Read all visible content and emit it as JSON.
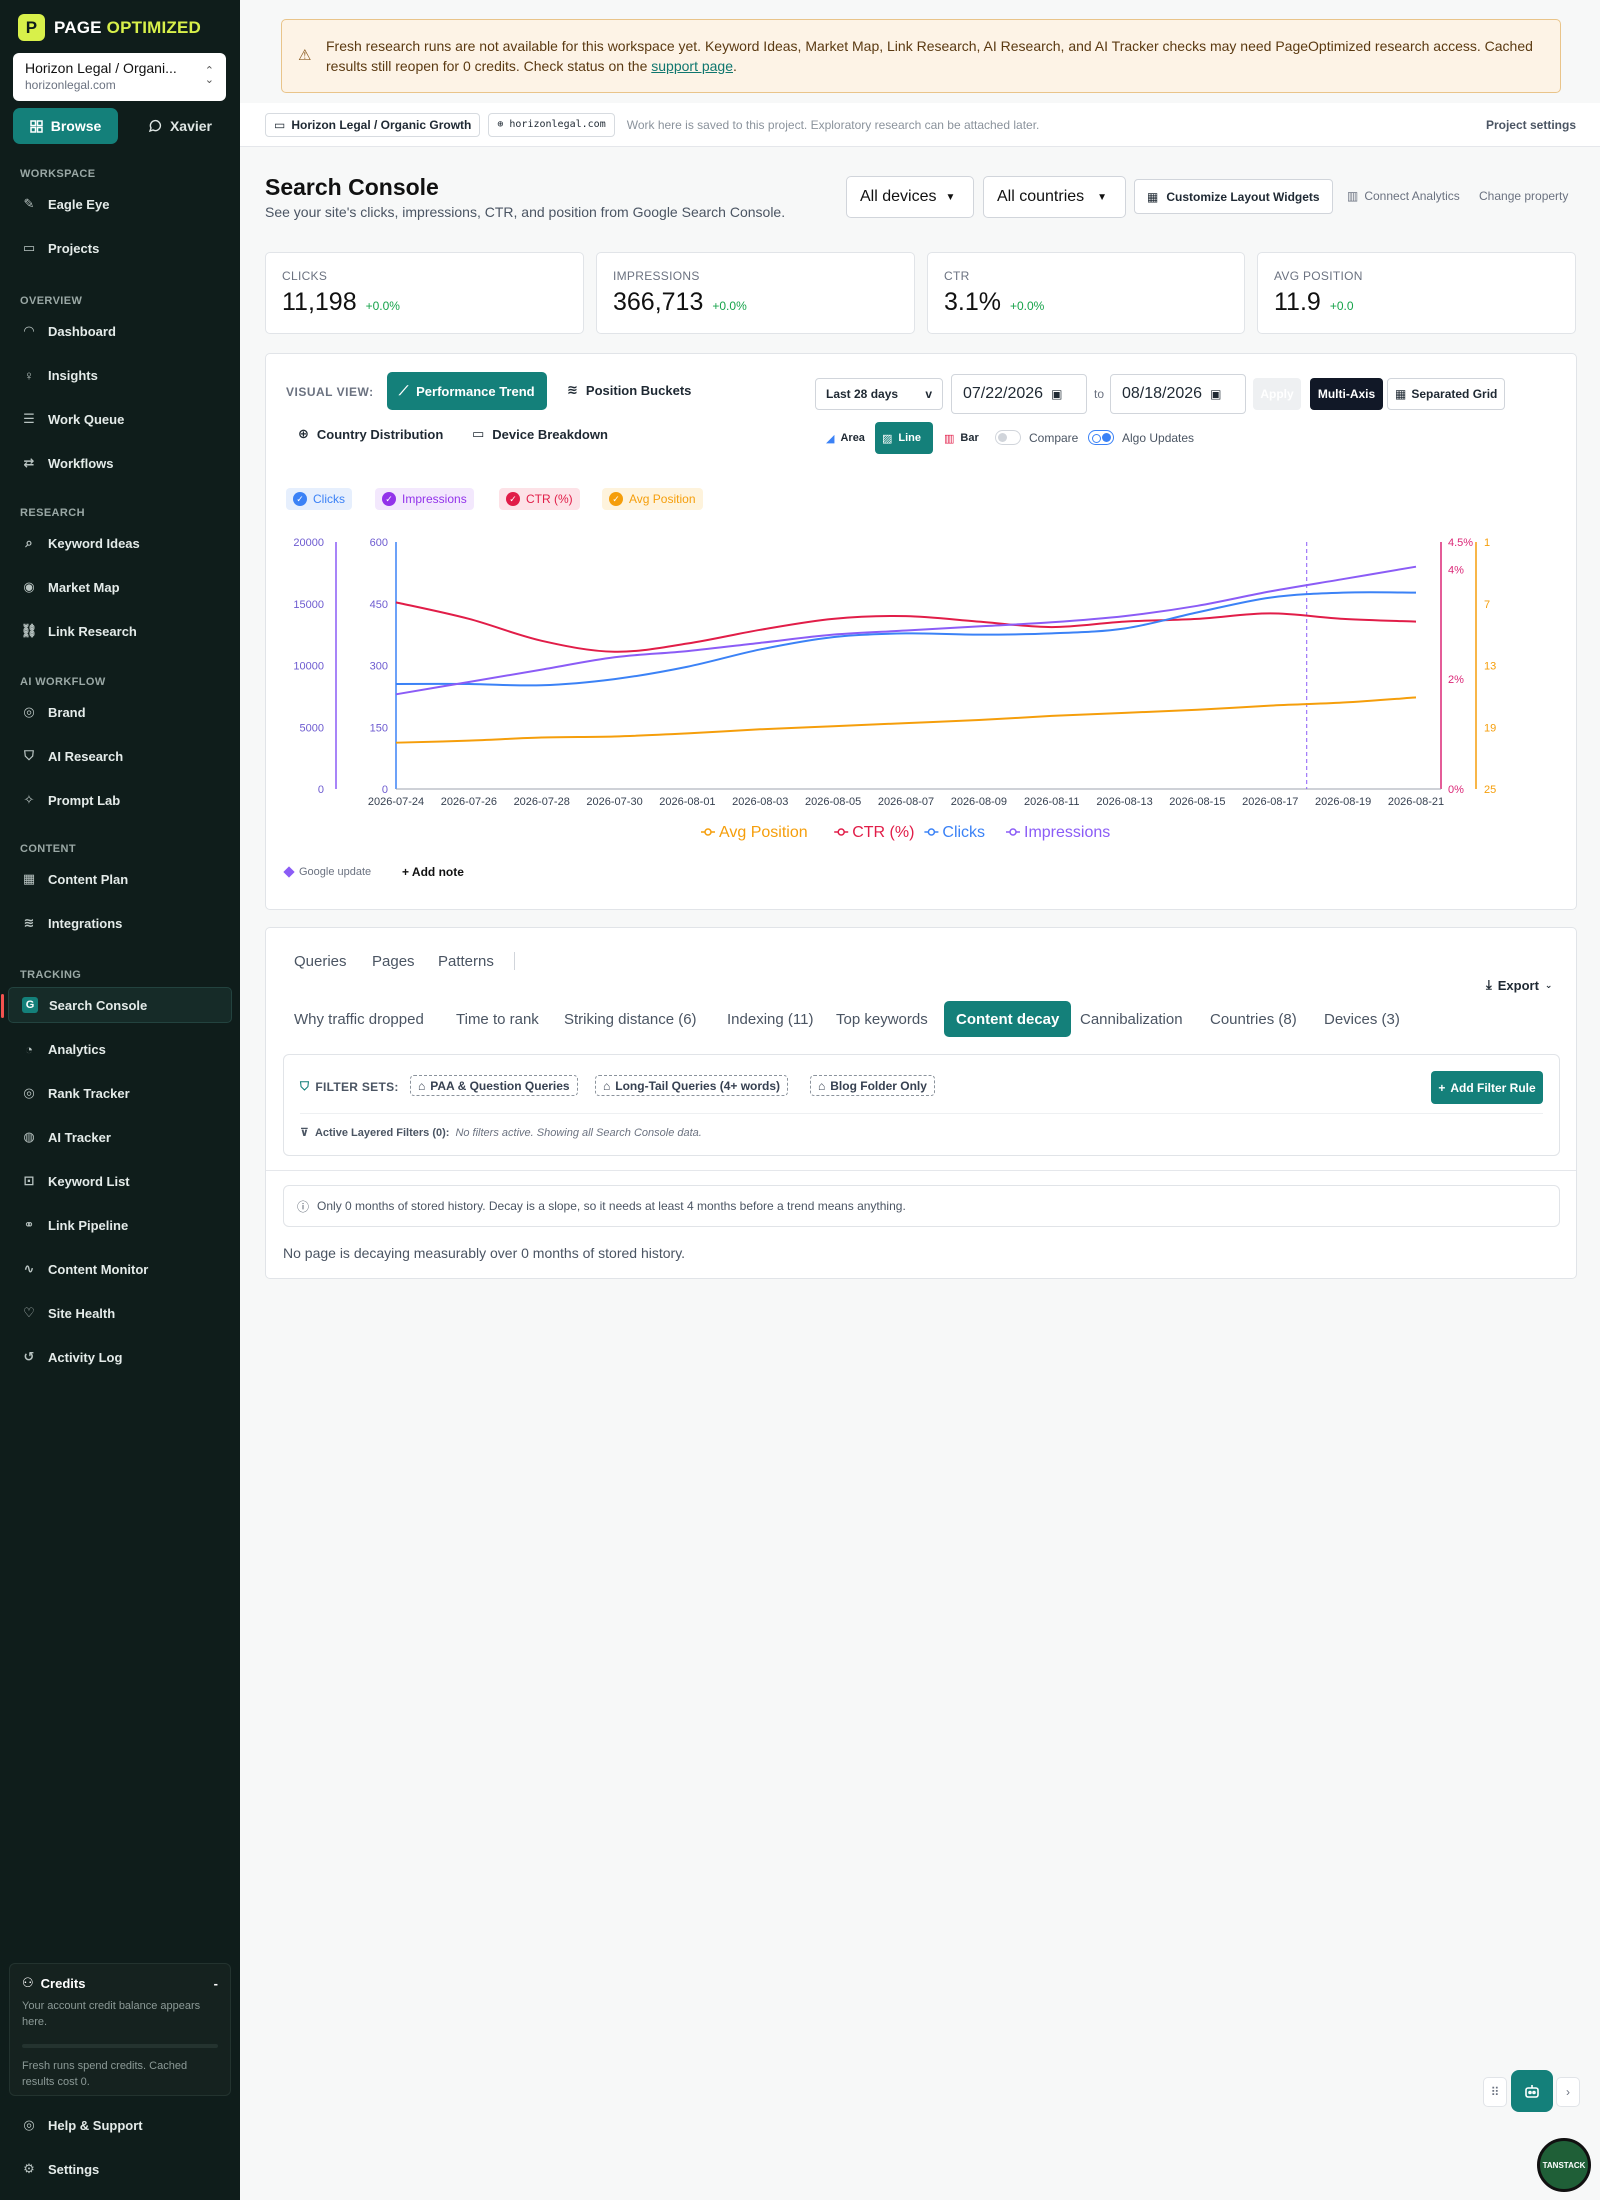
{
  "brand": {
    "name_a": "PAGE",
    "name_b": "OPTIMIZED",
    "mark": "P"
  },
  "project_switcher": {
    "name": "Horizon Legal / Organi...",
    "domain": "horizonlegal.com"
  },
  "mode_tabs": {
    "browse": "Browse",
    "xavier": "Xavier"
  },
  "sidebar": {
    "sections": [
      {
        "title": "WORKSPACE",
        "items": [
          {
            "label": "Eagle Eye",
            "icon": "eagle-icon"
          },
          {
            "label": "Projects",
            "icon": "projects-icon"
          }
        ]
      },
      {
        "title": "OVERVIEW",
        "items": [
          {
            "label": "Dashboard",
            "icon": "gauge-icon"
          },
          {
            "label": "Insights",
            "icon": "bulb-icon"
          },
          {
            "label": "Work Queue",
            "icon": "queue-icon"
          },
          {
            "label": "Workflows",
            "icon": "workflow-icon"
          }
        ]
      },
      {
        "title": "RESEARCH",
        "items": [
          {
            "label": "Keyword Ideas",
            "icon": "search-icon"
          },
          {
            "label": "Market Map",
            "icon": "map-icon"
          },
          {
            "label": "Link Research",
            "icon": "link-icon"
          }
        ]
      },
      {
        "title": "AI WORKFLOW",
        "items": [
          {
            "label": "Brand",
            "icon": "target-icon"
          },
          {
            "label": "AI Research",
            "icon": "shield-icon"
          },
          {
            "label": "Prompt Lab",
            "icon": "sparkle-icon"
          }
        ]
      },
      {
        "title": "CONTENT",
        "items": [
          {
            "label": "Content Plan",
            "icon": "calendar-icon"
          },
          {
            "label": "Integrations",
            "icon": "layers-icon"
          }
        ]
      },
      {
        "title": "TRACKING",
        "items": [
          {
            "label": "Search Console",
            "icon": "google-icon"
          },
          {
            "label": "Analytics",
            "icon": "analytics-icon"
          },
          {
            "label": "Rank Tracker",
            "icon": "rank-icon"
          },
          {
            "label": "AI Tracker",
            "icon": "ai-tracker-icon"
          },
          {
            "label": "Keyword List",
            "icon": "bookmark-icon"
          },
          {
            "label": "Link Pipeline",
            "icon": "pipeline-icon"
          },
          {
            "label": "Content Monitor",
            "icon": "pulse-icon"
          },
          {
            "label": "Site Health",
            "icon": "health-icon"
          },
          {
            "label": "Activity Log",
            "icon": "history-icon"
          }
        ]
      }
    ],
    "active": "Search Console",
    "credits": {
      "title": "Credits",
      "collapse": "-",
      "text": "Your account credit balance appears here.",
      "note": "Fresh runs spend credits. Cached results cost 0."
    },
    "help": "Help & Support",
    "settings": "Settings"
  },
  "banner": {
    "text": "Fresh research runs are not available for this workspace yet. Keyword Ideas, Market Map, Link Research, AI Research, and AI Tracker checks may need PageOptimized research access. Cached results still reopen for 0 credits. Check status on the",
    "link": "support page",
    "end": "."
  },
  "topbar": {
    "project": "Horizon Legal / Organic Growth",
    "domain": "horizonlegal.com",
    "note": "Work here is saved to this project. Exploratory research can be attached later.",
    "settings": "Project settings"
  },
  "header": {
    "title": "Search Console",
    "subtitle": "See your site's clicks, impressions, CTR, and position from Google Search Console.",
    "device": "All devices",
    "country": "All countries",
    "customize": "Customize Layout Widgets",
    "connect": "Connect Analytics",
    "change": "Change property"
  },
  "metrics": [
    {
      "label": "CLICKS",
      "value": "11,198",
      "delta": "+0.0%"
    },
    {
      "label": "IMPRESSIONS",
      "value": "366,713",
      "delta": "+0.0%"
    },
    {
      "label": "CTR",
      "value": "3.1%",
      "delta": "+0.0%"
    },
    {
      "label": "AVG POSITION",
      "value": "11.9",
      "delta": "+0.0"
    }
  ],
  "controls": {
    "visual_view": "VISUAL VIEW:",
    "views": [
      "Performance Trend",
      "Position Buckets",
      "Country Distribution",
      "Device Breakdown"
    ],
    "range": "Last 28 days",
    "range_caret": "v",
    "date_from": "07/22/2026",
    "to": "to",
    "date_to": "08/18/2026",
    "apply": "Apply",
    "multi_axis": "Multi-Axis",
    "separated": "Separated Grid",
    "chart_types": [
      "Area",
      "Line",
      "Bar"
    ],
    "compare": "Compare",
    "algo": "Algo Updates",
    "google_update": "Google update",
    "add_note": "Add note"
  },
  "legend_chips": [
    {
      "label": "Clicks",
      "color": "#3b82f6",
      "bg": "#e6effd"
    },
    {
      "label": "Impressions",
      "color": "#9333ea",
      "bg": "#f3e8fd"
    },
    {
      "label": "CTR (%)",
      "color": "#e11d48",
      "bg": "#fde2e7"
    },
    {
      "label": "Avg Position",
      "color": "#f59e0b",
      "bg": "#fef3dc"
    }
  ],
  "chart_data": {
    "type": "line",
    "x": [
      "2026-07-24",
      "2026-07-26",
      "2026-07-28",
      "2026-07-30",
      "2026-08-01",
      "2026-08-03",
      "2026-08-05",
      "2026-08-07",
      "2026-08-09",
      "2026-08-11",
      "2026-08-13",
      "2026-08-15",
      "2026-08-17",
      "2026-08-19",
      "2026-08-21"
    ],
    "series": [
      {
        "name": "Avg Position",
        "color": "#f59e0b",
        "axis": "pos",
        "values": [
          20.5,
          20.3,
          20,
          19.9,
          19.6,
          19.2,
          18.9,
          18.6,
          18.3,
          17.9,
          17.6,
          17.3,
          16.9,
          16.6,
          16.1
        ]
      },
      {
        "name": "CTR (%)",
        "color": "#e11d48",
        "axis": "ctr",
        "values": [
          3.4,
          3.1,
          2.7,
          2.5,
          2.65,
          2.9,
          3.1,
          3.15,
          3.05,
          2.95,
          3.05,
          3.1,
          3.2,
          3.1,
          3.05
        ]
      },
      {
        "name": "Clicks",
        "color": "#3b82f6",
        "axis": "clicks",
        "values": [
          8500,
          8500,
          8400,
          8900,
          9900,
          11300,
          12300,
          12600,
          12500,
          12600,
          13000,
          14300,
          15500,
          15900,
          15900
        ]
      },
      {
        "name": "Impressions",
        "color": "#8b5cf6",
        "axis": "impr",
        "values": [
          230,
          260,
          290,
          320,
          335,
          355,
          375,
          385,
          395,
          405,
          420,
          445,
          480,
          510,
          540
        ]
      }
    ],
    "axes": {
      "clicks": {
        "range": [
          0,
          20000
        ],
        "ticks": [
          "20000",
          "15000",
          "10000",
          "5000",
          "0"
        ],
        "color": "#6d5bd0"
      },
      "impr": {
        "range": [
          0,
          600
        ],
        "ticks": [
          "600",
          "450",
          "300",
          "150",
          "0"
        ],
        "color": "#6d5bd0"
      },
      "ctr": {
        "range": [
          0,
          4.5
        ],
        "ticks": [
          "4.5%",
          "4%",
          "2%",
          "0%"
        ],
        "tick_values": [
          4.5,
          4,
          2,
          0
        ],
        "color": "#db2777"
      },
      "pos": {
        "range": [
          25,
          1
        ],
        "ticks": [
          "1",
          "7",
          "13",
          "19",
          "25"
        ],
        "color": "#f59e0b"
      }
    },
    "algo_update_date": "2026-08-18",
    "grid": false,
    "legend": "bottom"
  },
  "tabs_top": [
    "Queries",
    "Pages",
    "Patterns"
  ],
  "tabs": [
    "Why traffic dropped",
    "Time to rank",
    "Striking distance (6)",
    "Indexing (11)",
    "Top keywords",
    "Content decay",
    "Cannibalization",
    "Countries (8)",
    "Devices (3)"
  ],
  "active_tab": "Content decay",
  "export": "Export",
  "filters": {
    "label": "FILTER SETS:",
    "sets": [
      "PAA & Question Queries",
      "Long-Tail Queries (4+ words)",
      "Blog Folder Only"
    ],
    "add": "Add Filter Rule",
    "active_label": "Active Layered Filters (0):",
    "active_note": "No filters active. Showing all Search Console data."
  },
  "decay": {
    "info": "Only 0 months of stored history. Decay is a slope, so it needs at least 4 months before a trend means anything.",
    "empty": "No page is decaying measurably over 0 months of stored history."
  },
  "badge": "TANSTACK"
}
